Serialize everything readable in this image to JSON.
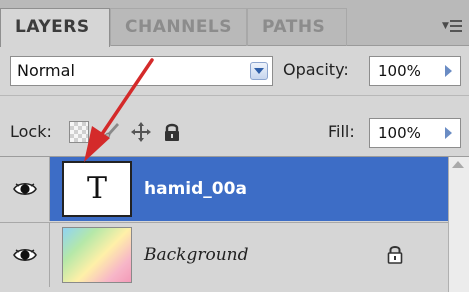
{
  "tabs": [
    {
      "label": "LAYERS",
      "active": true
    },
    {
      "label": "CHANNELS",
      "active": false
    },
    {
      "label": "PATHS",
      "active": false
    }
  ],
  "panel_menu_icon": "panel-menu-icon",
  "blend_mode": {
    "value": "Normal"
  },
  "opacity": {
    "label": "Opacity:",
    "value": "100%"
  },
  "lock": {
    "label": "Lock:",
    "icons": [
      "lock-transparent-icon",
      "brush-icon",
      "move-icon",
      "padlock-icon"
    ]
  },
  "fill": {
    "label": "Fill:",
    "value": "100%"
  },
  "layers": [
    {
      "name": "hamid_00a",
      "thumbnail_glyph": "T",
      "selected": true,
      "visible": true,
      "locked": false
    },
    {
      "name": "Background",
      "thumbnail": "gradient",
      "selected": false,
      "visible": true,
      "locked": true
    }
  ],
  "colors": {
    "selection": "#3d6dc6",
    "annotation_arrow": "#d42a2a",
    "panel_bg": "#d6d6d6"
  }
}
